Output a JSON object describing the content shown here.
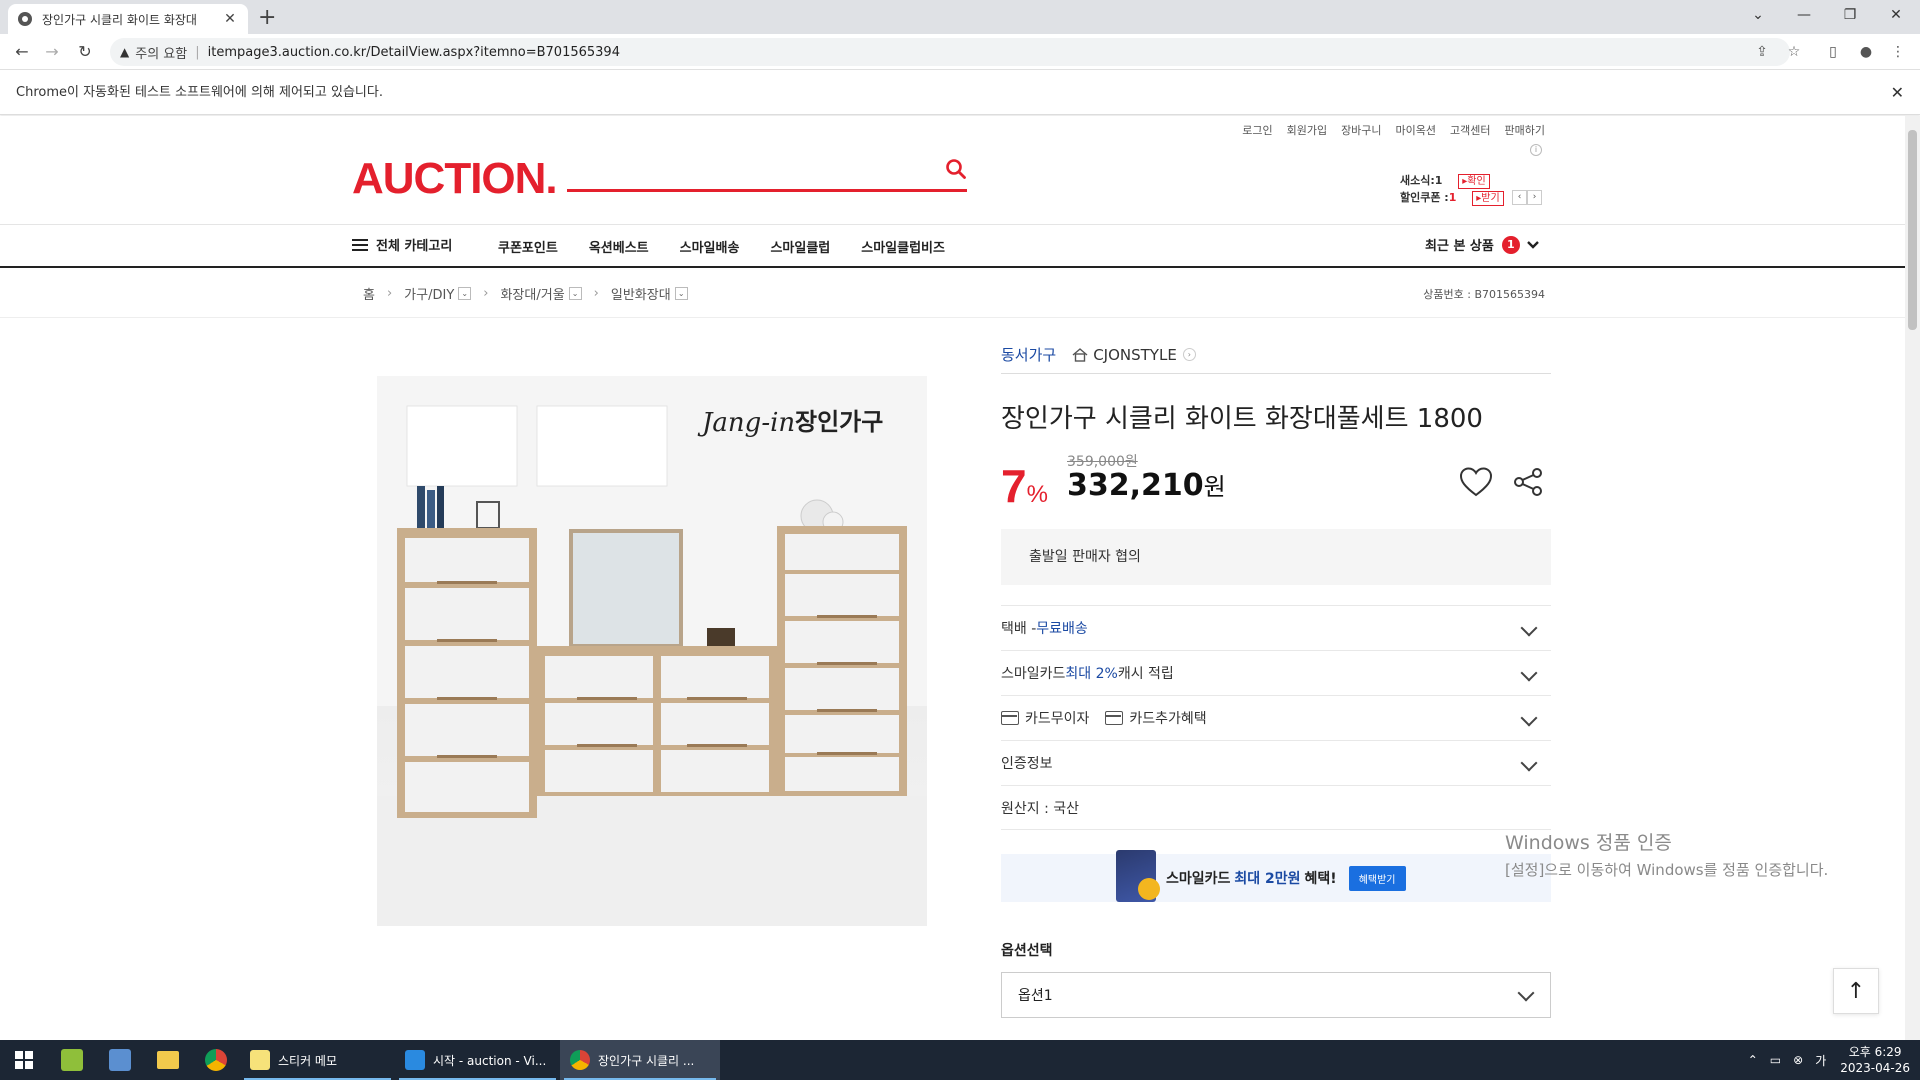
{
  "browser": {
    "tab_title": "장인가구 시클리 화이트 화장대",
    "security_label": "주의 요함",
    "url": "itempage3.auction.co.kr/DetailView.aspx?itemno=B701565394",
    "automation_notice": "Chrome이 자동화된 테스트 소프트웨어에 의해 제어되고 있습니다."
  },
  "header": {
    "util_links": [
      "로그인",
      "회원가입",
      "장바구니",
      "마이옥션",
      "고객센터",
      "판매하기"
    ],
    "logo": "AUCTION.",
    "search_placeholder": "",
    "mini": {
      "new_label": "새소식:",
      "new_count": "1",
      "new_btn": "확인",
      "coupon_label": "할인쿠폰 :",
      "coupon_count": "1",
      "coupon_btn": "받기"
    }
  },
  "gnb": {
    "all_category": "전체 카테고리",
    "menu": [
      "쿠폰포인트",
      "옥션베스트",
      "스마일배송",
      "스마일클럽",
      "스마일클럽비즈"
    ],
    "recent_label": "최근 본 상품",
    "recent_count": "1"
  },
  "breadcrumb": {
    "home": "홈",
    "levels": [
      "가구/DIY",
      "화장대/거울",
      "일반화장대"
    ],
    "item_number": "상품번호 : B701565394"
  },
  "product": {
    "image_brand": "장인가구",
    "image_brand_script": "Jang-in",
    "seller_brand": "동서가구",
    "store_name": "CJONSTYLE",
    "title": "장인가구 시클리 화이트 화장대풀세트 1800",
    "discount": "7",
    "discount_unit": "%",
    "original_price": "359,000원",
    "sale_price": "332,210",
    "sale_unit": "원",
    "ship_notice": "출발일 판매자 협의",
    "rows": {
      "delivery_prefix": "택배 - ",
      "delivery_value": "무료배송",
      "card_prefix": "스마일카드 ",
      "card_value": "최대 2%",
      "card_suffix": " 캐시 적립",
      "no_interest": "카드무이자",
      "card_benefit": "카드추가혜택",
      "certification": "인증정보",
      "origin": "원산지 : 국산"
    },
    "banner": {
      "prefix": "스마일카드",
      "highlight": "최대 2만원",
      "suffix": "혜택!",
      "button": "혜택받기"
    },
    "option_label": "옵션선택",
    "option_value": "옵션1"
  },
  "watermark": {
    "line1": "Windows 정품 인증",
    "line2": "[설정]으로 이동하여 Windows를 정품 인증합니다."
  },
  "taskbar": {
    "apps": [
      "스티커 메모",
      "시작 - auction - Vi...",
      "장인가구 시클리 ..."
    ],
    "time": "오후 6:29",
    "date": "2023-04-26"
  },
  "colors": {
    "accent": "#e4202d",
    "link_blue": "#1b4aa3",
    "taskbar": "#1c2634"
  }
}
